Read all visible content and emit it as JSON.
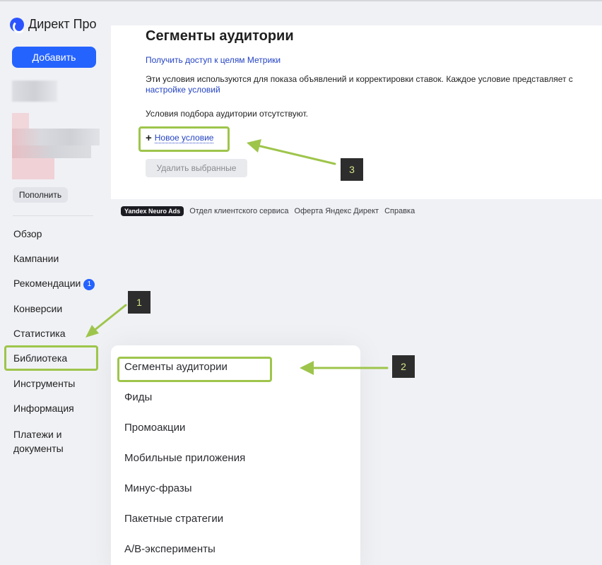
{
  "sidebar": {
    "logo": "Директ Про",
    "add_label": "Добавить",
    "topup_label": "Пополнить",
    "nav": [
      {
        "label": "Обзор"
      },
      {
        "label": "Кампании"
      },
      {
        "label": "Рекомендации",
        "badge": "1"
      },
      {
        "label": "Конверсии"
      },
      {
        "label": "Статистика"
      },
      {
        "label": "Библиотека"
      },
      {
        "label": "Инструменты"
      },
      {
        "label": "Информация"
      },
      {
        "label": "Платежи и\nдокументы"
      }
    ]
  },
  "main": {
    "title": "Сегменты аудитории",
    "metrika_link": "Получить доступ к целям Метрики",
    "description": "Эти условия используются для показа объявлений и корректировки ставок. Каждое условие представляет с",
    "desc_link": "настройке условий",
    "empty_message": "Условия подбора аудитории отсутствуют.",
    "new_condition": "Новое условие",
    "delete_selected": "Удалить выбранные"
  },
  "footer": {
    "brand": "Yandex Neuro Ads",
    "links": [
      "Отдел клиентского сервиса",
      "Оферта Яндекс Директ",
      "Справка"
    ]
  },
  "library_menu": {
    "items": [
      "Сегменты аудитории",
      "Фиды",
      "Промоакции",
      "Мобильные приложения",
      "Минус-фразы",
      "Пакетные стратегии",
      "A/B-эксперименты"
    ]
  },
  "annotations": {
    "steps": [
      "1",
      "2",
      "3"
    ],
    "accent": "#9ec54b"
  }
}
